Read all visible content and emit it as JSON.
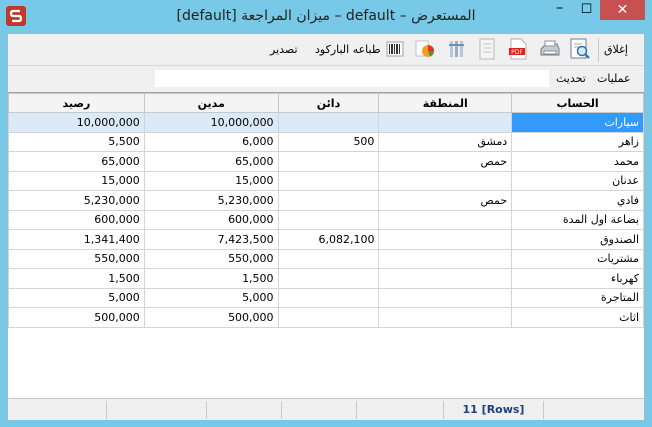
{
  "window": {
    "title": "المستعرض – default – ميزان المراجعة [default]",
    "minimize_glyph": "–",
    "maximize_glyph": "☐",
    "close_glyph": "✕"
  },
  "toolbar": {
    "close_label": "إغلاق",
    "barcode_print_label": "طباعه الباركود",
    "export_label": "تصدير",
    "icons": [
      "preview-icon",
      "print-icon",
      "pdf-icon",
      "document-icon",
      "columns-icon",
      "chart-icon",
      "barcode-icon"
    ]
  },
  "menu": {
    "operations_label": "عمليات",
    "refresh_label": "تحديث"
  },
  "table": {
    "columns": [
      "رصيد",
      "مدين",
      "دائن",
      "المنطقة",
      "الحساب"
    ],
    "rows": [
      {
        "balance": "10,000,000",
        "debit": "10,000,000",
        "credit": "",
        "region": "",
        "account": "سيارات"
      },
      {
        "balance": "5,500",
        "debit": "6,000",
        "credit": "500",
        "region": "دمشق",
        "account": "زاهر"
      },
      {
        "balance": "65,000",
        "debit": "65,000",
        "credit": "",
        "region": "حمص",
        "account": "محمد"
      },
      {
        "balance": "15,000",
        "debit": "15,000",
        "credit": "",
        "region": "",
        "account": "عدنان"
      },
      {
        "balance": "5,230,000",
        "debit": "5,230,000",
        "credit": "",
        "region": "حمص",
        "account": "فادي"
      },
      {
        "balance": "600,000",
        "debit": "600,000",
        "credit": "",
        "region": "",
        "account": "بضاعة اول المدة"
      },
      {
        "balance": "1,341,400",
        "debit": "7,423,500",
        "credit": "6,082,100",
        "region": "",
        "account": "الصندوق"
      },
      {
        "balance": "550,000",
        "debit": "550,000",
        "credit": "",
        "region": "",
        "account": "مشتريات"
      },
      {
        "balance": "1,500",
        "debit": "1,500",
        "credit": "",
        "region": "",
        "account": "كهرباء"
      },
      {
        "balance": "5,000",
        "debit": "5,000",
        "credit": "",
        "region": "",
        "account": "المتاجرة"
      },
      {
        "balance": "500,000",
        "debit": "500,000",
        "credit": "",
        "region": "",
        "account": "اثاث"
      }
    ]
  },
  "status": {
    "rows_label": "11 [Rows]"
  },
  "colors": {
    "title_bar": "#78c8e8",
    "close_button": "#c75050",
    "selection": "#3399ff",
    "selected_row": "#dce9f8",
    "status_text": "#1f3f7f"
  }
}
